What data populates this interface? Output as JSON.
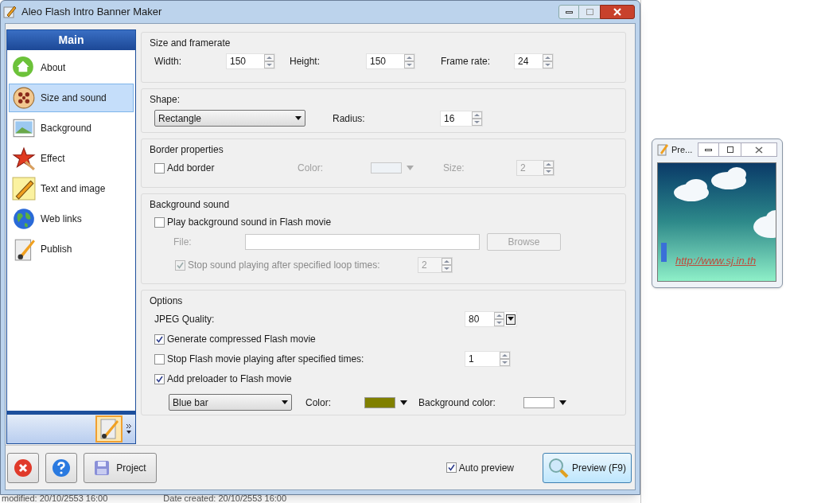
{
  "window": {
    "title": "Aleo Flash Intro Banner Maker"
  },
  "sidebar": {
    "header": "Main",
    "items": [
      {
        "label": "About",
        "selected": false
      },
      {
        "label": "Size and sound",
        "selected": true
      },
      {
        "label": "Background",
        "selected": false
      },
      {
        "label": "Effect",
        "selected": false
      },
      {
        "label": "Text and image",
        "selected": false
      },
      {
        "label": "Web links",
        "selected": false
      },
      {
        "label": "Publish",
        "selected": false
      }
    ]
  },
  "size_and_framerate": {
    "title": "Size and framerate",
    "fields": [
      {
        "label": "Width:",
        "value": "150"
      },
      {
        "label": "Height:",
        "value": "150"
      },
      {
        "label": "Frame rate:",
        "value": "24"
      }
    ]
  },
  "shape": {
    "title": "Shape:",
    "value": "Rectangle",
    "radius_label": "Radius:",
    "radius": "16"
  },
  "border": {
    "title": "Border properties",
    "add_border": {
      "label": "Add border",
      "checked": false
    },
    "color_label": "Color:",
    "size_label": "Size:",
    "size": "2",
    "disabled": true
  },
  "background_sound": {
    "title": "Background sound",
    "play": {
      "label": "Play background sound in Flash movie",
      "checked": false
    },
    "file_label": "File:",
    "browse": "Browse",
    "stop": {
      "label": "Stop sound playing after specified loop times:",
      "checked": true
    },
    "loop_times": "2",
    "disabled": true
  },
  "options": {
    "title": "Options",
    "jpeg_label": "JPEG Quality:",
    "jpeg": "80",
    "compressed": {
      "label": "Generate compressed Flash movie",
      "checked": true
    },
    "stop": {
      "label": "Stop Flash movie playing after specified times:",
      "checked": false,
      "value": "1"
    },
    "preloader": {
      "label": "Add preloader to Flash movie",
      "checked": true
    },
    "preloader_style": "Blue bar",
    "swatches": [
      {
        "label": "Color:",
        "color": "#808000"
      },
      {
        "label": "Background color:",
        "color": "#ffffff"
      }
    ]
  },
  "footer": {
    "project": "Project",
    "auto_preview": {
      "label": "Auto preview",
      "checked": true
    },
    "preview": "Preview (F9)"
  },
  "preview_window": {
    "title": "Pre...",
    "link": "http://www.sj.in.th"
  },
  "background_window": {
    "status": [
      "modified: 20/10/2553 16:00",
      "Date created: 20/10/2553 16:00"
    ]
  }
}
